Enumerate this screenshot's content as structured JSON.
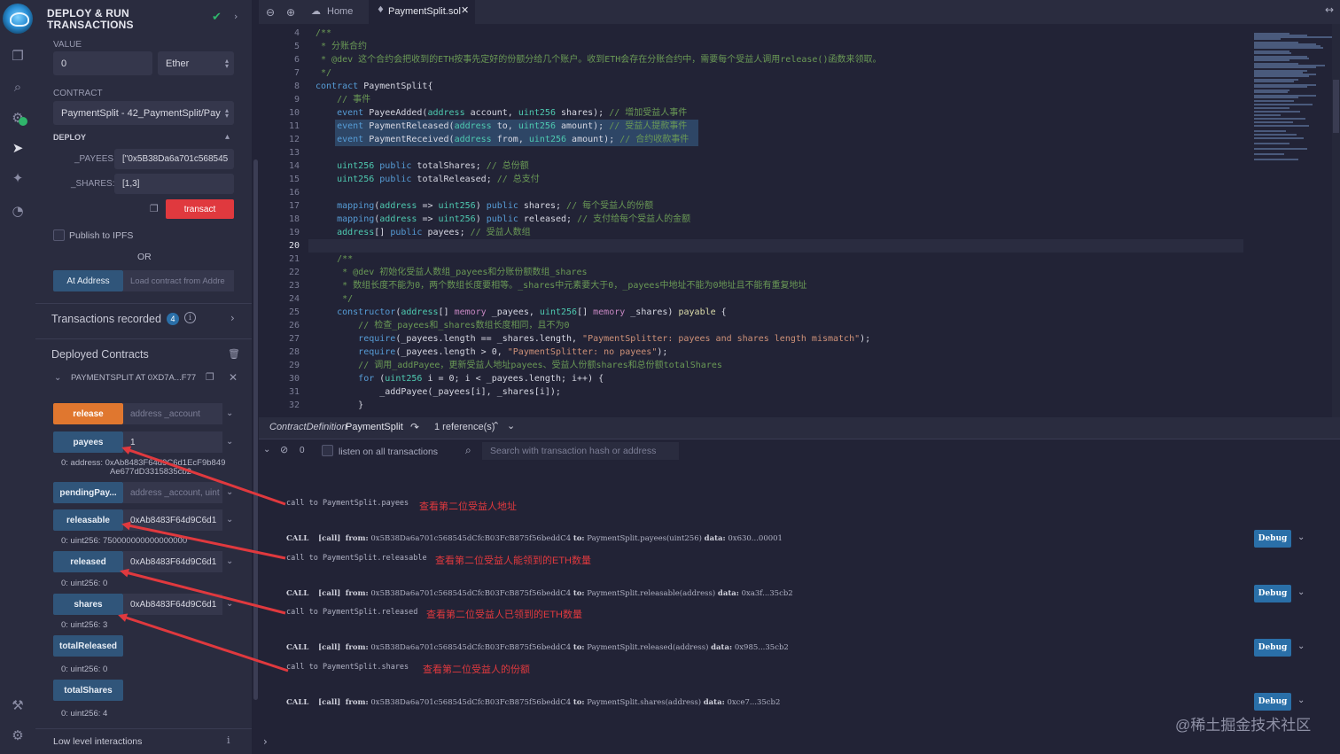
{
  "sidebar": {
    "title_line1": "DEPLOY & RUN",
    "title_line2": "TRANSACTIONS",
    "value_label": "VALUE",
    "value": "0",
    "unit": "Ether",
    "contract_label": "CONTRACT",
    "contract": "PaymentSplit - 42_PaymentSplit/Pay",
    "deploy_label": "DEPLOY",
    "payees_label": "_PAYEES:",
    "payees_value": "[\"0x5B38Da6a701c568545",
    "shares_label": "_SHARES:",
    "shares_value": "[1,3]",
    "transact": "transact",
    "publish_ipfs": "Publish to IPFS",
    "or": "OR",
    "at_address": "At Address",
    "load_placeholder": "Load contract from Addre",
    "tx_recorded": "Transactions recorded",
    "tx_count": "4",
    "deployed_title": "Deployed Contracts",
    "instance": "PAYMENTSPLIT AT 0XD7A...F77",
    "low_level": "Low level interactions"
  },
  "functions": [
    {
      "label": "release",
      "input": "address _account",
      "result": ""
    },
    {
      "label": "payees",
      "input": "1",
      "result": "0: address: 0xAb8483F64d9C6d1EcF9b849",
      "result2": "Ae677dD3315835cb2"
    },
    {
      "label": "pendingPay...",
      "input": "address _account, uint",
      "result": ""
    },
    {
      "label": "releasable",
      "input": "0xAb8483F64d9C6d1",
      "result": "0: uint256: 750000000000000000"
    },
    {
      "label": "released",
      "input": "0xAb8483F64d9C6d1",
      "result": "0: uint256: 0"
    },
    {
      "label": "shares",
      "input": "0xAb8483F64d9C6d1",
      "result": "0: uint256: 3"
    },
    {
      "label": "totalReleased",
      "input": "",
      "result": "0: uint256: 0"
    },
    {
      "label": "totalShares",
      "input": "",
      "result": "0: uint256: 4"
    }
  ],
  "tabs": {
    "home": "Home",
    "file": "PaymentSplit.sol"
  },
  "editor": {
    "line_numbers": [
      "4",
      "5",
      "6",
      "7",
      "8",
      "9",
      "10",
      "11",
      "12",
      "13",
      "14",
      "15",
      "16",
      "17",
      "18",
      "19",
      "20",
      "21",
      "22",
      "23",
      "24",
      "25",
      "26",
      "27",
      "28",
      "29",
      "30",
      "31",
      "32"
    ],
    "current_line": "20"
  },
  "refbar": {
    "kind": "ContractDefinition",
    "name": "PaymentSplit",
    "refs": "1 reference(s)"
  },
  "terminal": {
    "count": "0",
    "listen": "listen on all transactions",
    "search_placeholder": "Search with transaction hash or address",
    "entries": [
      {
        "call": "call to PaymentSplit.payees",
        "note": "查看第二位受益人地址",
        "tx_to": "PaymentSplit.payees(uint256)",
        "data": "0x630...00001"
      },
      {
        "call": "call to PaymentSplit.releasable",
        "note": "查看第二位受益人能领到的ETH数量",
        "tx_to": "PaymentSplit.releasable(address)",
        "data": "0xa3f...35cb2"
      },
      {
        "call": "call to PaymentSplit.released",
        "note": "查看第二位受益人已领到的ETH数量",
        "tx_to": "PaymentSplit.released(address)",
        "data": "0x985...35cb2"
      },
      {
        "call": "call to PaymentSplit.shares",
        "note": "查看第二位受益人的份额",
        "tx_to": "PaymentSplit.shares(address)",
        "data": "0xce7...35cb2"
      }
    ],
    "call_tag": "CALL",
    "call_kind": "[call]",
    "from_label": "from:",
    "from_addr": "0x5B38Da6a701c568545dCfcB03FcB875f56beddC4",
    "to_label": "to:",
    "data_label": "data:",
    "debug": "Debug"
  },
  "watermark": "@稀土掘金技术社区"
}
